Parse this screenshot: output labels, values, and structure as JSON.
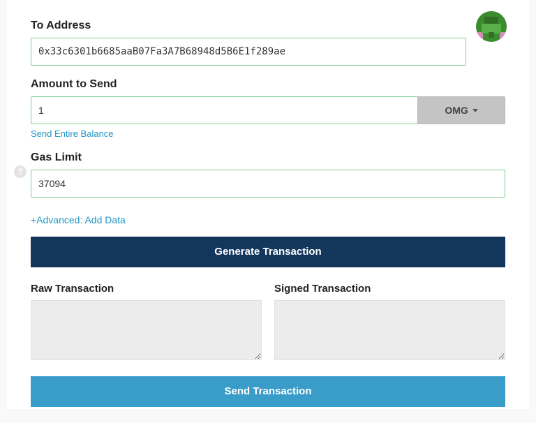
{
  "toAddress": {
    "label": "To Address",
    "value": "0x33c6301b6685aaB07Fa3A7B68948d5B6E1f289ae"
  },
  "amount": {
    "label": "Amount to Send",
    "value": "1",
    "unit": "OMG",
    "entireBalanceLink": "Send Entire Balance"
  },
  "gasLimit": {
    "label": "Gas Limit",
    "value": "37094"
  },
  "advancedLink": "+Advanced: Add Data",
  "generateBtn": "Generate Transaction",
  "rawTx": {
    "label": "Raw Transaction",
    "value": ""
  },
  "signedTx": {
    "label": "Signed Transaction",
    "value": ""
  },
  "sendBtn": "Send Transaction",
  "helpTooltip": "?",
  "colors": {
    "accent": "#3a9cc8",
    "dark": "#13365d",
    "link": "#1f95c4",
    "fieldBorder": "#7fcf92"
  }
}
